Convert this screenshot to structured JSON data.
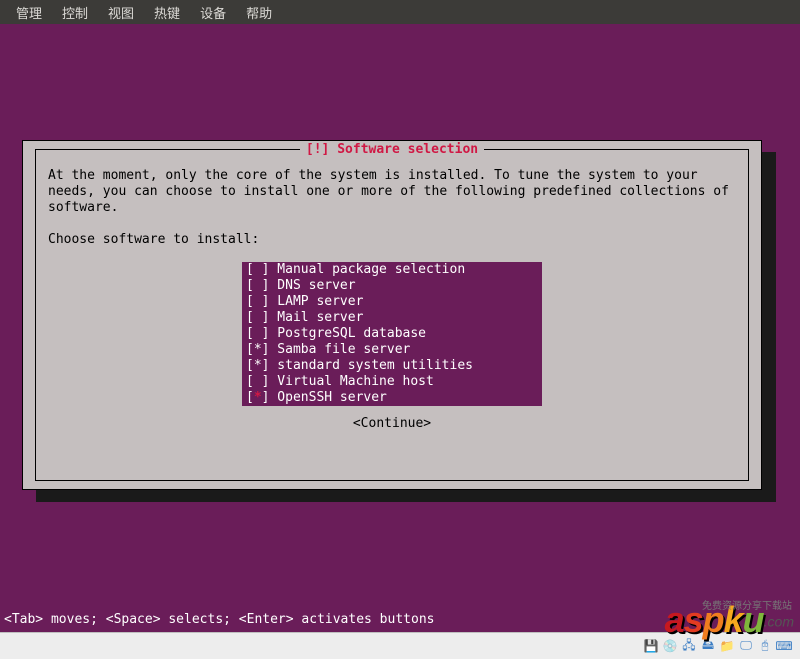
{
  "menubar": {
    "items": [
      "管理",
      "控制",
      "视图",
      "热键",
      "设备",
      "帮助"
    ]
  },
  "dialog": {
    "title": "[!] Software selection",
    "body_line1": "At the moment, only the core of the system is installed. To tune the system to your",
    "body_line2": "needs, you can choose to install one or more of the following predefined collections of",
    "body_line3": "software.",
    "prompt": "Choose software to install:",
    "choices": [
      {
        "selected": false,
        "cursor": false,
        "label": "Manual package selection"
      },
      {
        "selected": false,
        "cursor": false,
        "label": "DNS server"
      },
      {
        "selected": false,
        "cursor": false,
        "label": "LAMP server"
      },
      {
        "selected": false,
        "cursor": false,
        "label": "Mail server"
      },
      {
        "selected": false,
        "cursor": false,
        "label": "PostgreSQL database"
      },
      {
        "selected": true,
        "cursor": false,
        "label": "Samba file server"
      },
      {
        "selected": true,
        "cursor": false,
        "label": "standard system utilities"
      },
      {
        "selected": false,
        "cursor": false,
        "label": "Virtual Machine host"
      },
      {
        "selected": true,
        "cursor": true,
        "label": "OpenSSH server"
      }
    ],
    "continue": "<Continue>"
  },
  "footer": "<Tab> moves; <Space> selects; <Enter> activates buttons",
  "watermark": {
    "tagline": "免费资源分享下载站",
    "brand": "aspku",
    "dotcom": ".com"
  }
}
